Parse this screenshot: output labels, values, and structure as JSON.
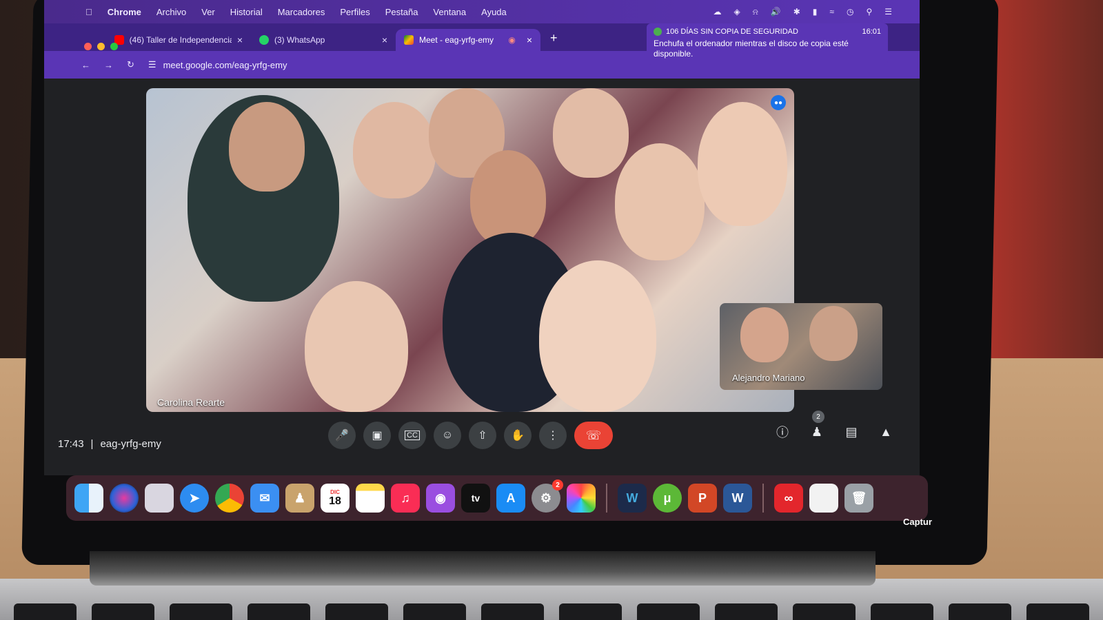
{
  "menubar": {
    "items": [
      "Chrome",
      "Archivo",
      "Ver",
      "Historial",
      "Marcadores",
      "Perfiles",
      "Pestaña",
      "Ventana",
      "Ayuda"
    ]
  },
  "tabs": [
    {
      "title": "(46) Taller de Independencia",
      "favicon": "youtube-icon",
      "active": false
    },
    {
      "title": "(3) WhatsApp",
      "favicon": "whatsapp-icon",
      "active": false
    },
    {
      "title": "Meet - eag-yrfg-emy",
      "favicon": "meet-icon",
      "active": true
    }
  ],
  "toolbar": {
    "url": "meet.google.com/eag-yrfg-emy"
  },
  "notification": {
    "title": "106 DÍAS SIN COPIA DE SEGURIDAD",
    "time": "16:01",
    "body": "Enchufa el ordenador mientras el disco de copia esté disponible."
  },
  "meet": {
    "main_participant": "Carolina Rearte",
    "self_participant": "Alejandro Mariano",
    "clock": "17:43",
    "separator": "|",
    "meeting_code": "eag-yrfg-emy",
    "people_count": "2"
  },
  "dock": {
    "calendar_month": "DIC",
    "calendar_day": "18",
    "appletv_label": "tv",
    "settings_badge": "2",
    "caption": "Captur"
  },
  "colors": {
    "chrome_theme": "#5a35b5",
    "end_call": "#ea4335",
    "meet_bg": "#202124"
  }
}
